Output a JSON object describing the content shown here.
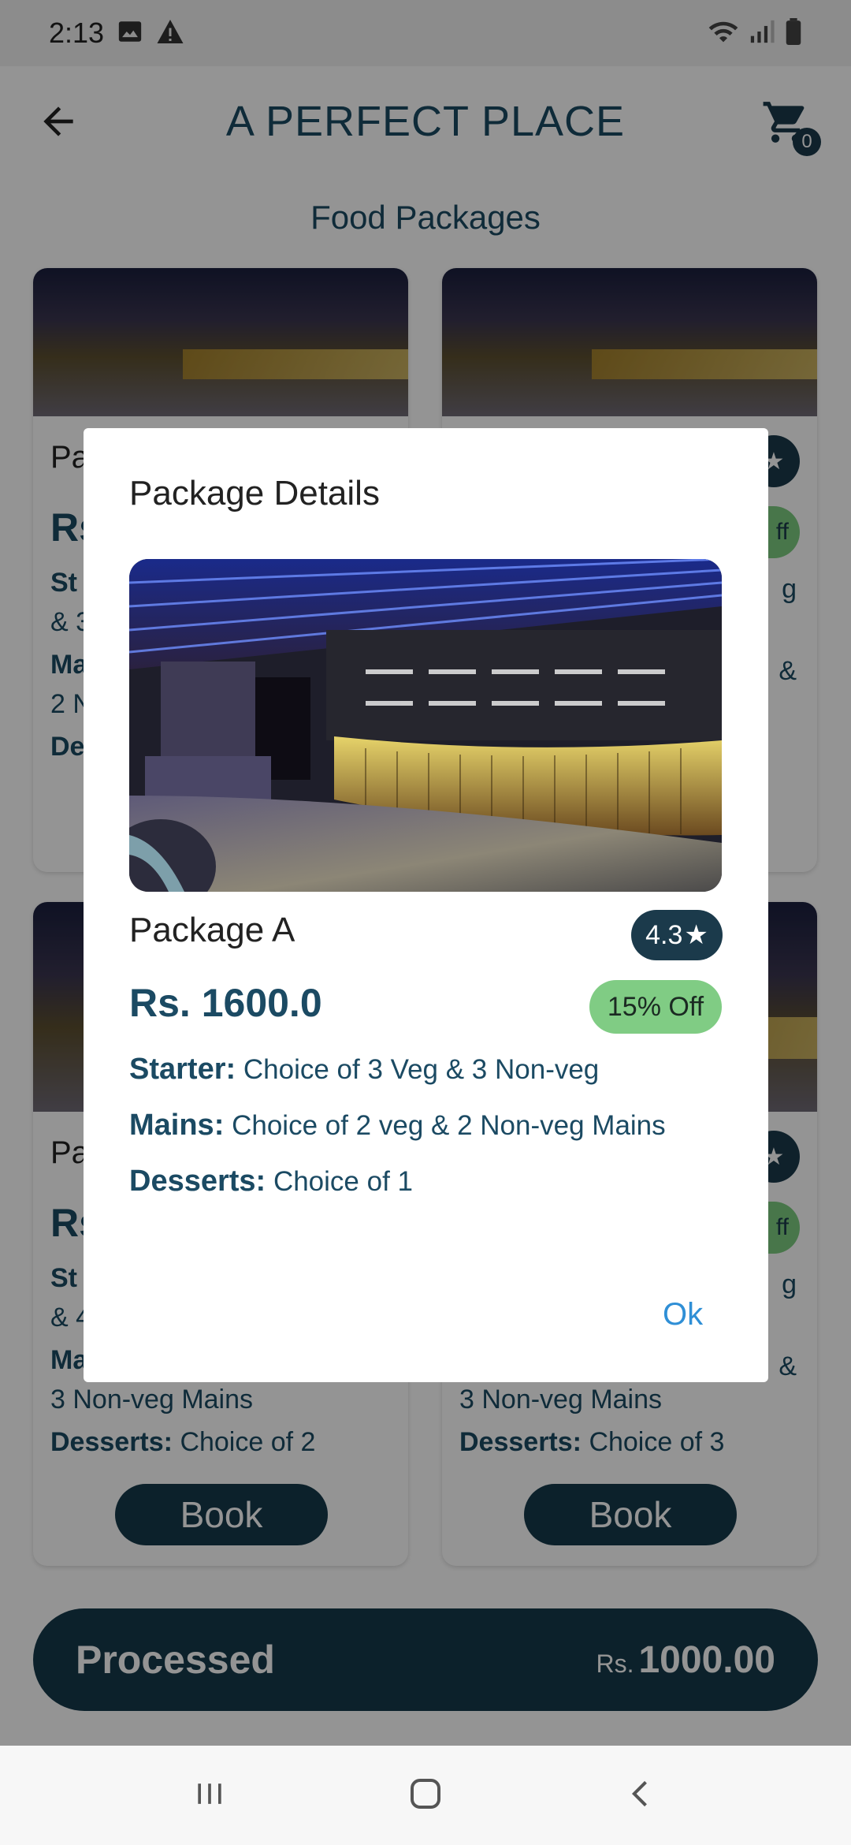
{
  "status_bar": {
    "time": "2:13"
  },
  "app_bar": {
    "title": "A PERFECT PLACE",
    "cart_count": "0"
  },
  "section_title": "Food Packages",
  "cards": [
    {
      "name": "Pa",
      "price": "Rs",
      "line1": "St",
      "line1b": "& 3",
      "line2": "Ma",
      "line2b": "2 N",
      "line3": "De"
    },
    {
      "rating": "★",
      "off": "ff",
      "line1": "g",
      "line2": "&"
    },
    {
      "name": "Pa",
      "price": "Rs",
      "line1": "St",
      "line1b": "& 4",
      "line2": "Ma",
      "line2b": "3 Non-veg Mains",
      "desserts_label": "Desserts:",
      "desserts_value": "Choice of 2",
      "book": "Book"
    },
    {
      "rating": "★",
      "off": "ff",
      "line1": "g",
      "line2": "&",
      "line2b": "3 Non-veg Mains",
      "desserts_label": "Desserts:",
      "desserts_value": "Choice of 3",
      "book": "Book"
    }
  ],
  "bottom_bar": {
    "label": "Processed",
    "currency": "Rs.",
    "amount": "1000.00"
  },
  "dialog": {
    "title": "Package Details",
    "package_name": "Package A",
    "rating": "4.3",
    "rating_star": "★",
    "price": "Rs. 1600.0",
    "discount": "15% Off",
    "details": [
      {
        "key": "Starter:",
        "value": " Choice of 3 Veg & 3 Non-veg"
      },
      {
        "key": "Mains:",
        "value": " Choice of 2 veg & 2 Non-veg Mains"
      },
      {
        "key": "Desserts:",
        "value": " Choice of 1"
      }
    ],
    "ok_label": "Ok"
  },
  "colors": {
    "primary": "#16394a",
    "accent_green": "#80cc84",
    "link": "#2f8fd6"
  },
  "icons": [
    "image-icon",
    "warning-icon",
    "wifi-icon",
    "signal-icon",
    "battery-icon",
    "back-arrow-icon",
    "cart-icon",
    "recents-icon",
    "home-icon",
    "nav-back-icon"
  ]
}
